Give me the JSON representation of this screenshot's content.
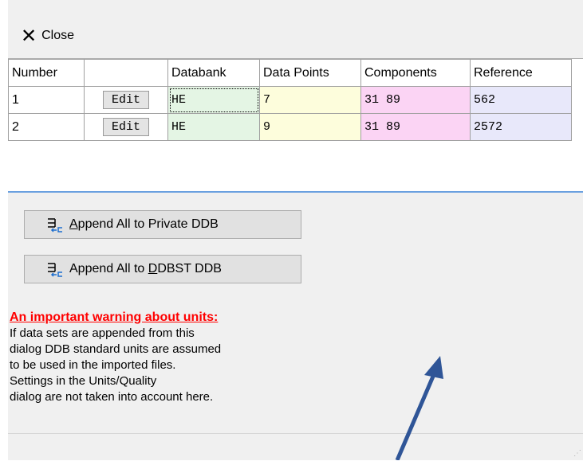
{
  "toolbar": {
    "close_label": "Close"
  },
  "table": {
    "headers": {
      "number": "Number",
      "edit": "",
      "databank": "Databank",
      "data_points": "Data Points",
      "components": "Components",
      "reference": "Reference"
    },
    "rows": [
      {
        "number": "1",
        "edit": "Edit",
        "databank": "HE",
        "data_points": "7",
        "components": "31 89",
        "reference": "562"
      },
      {
        "number": "2",
        "edit": "Edit",
        "databank": "HE",
        "data_points": "9",
        "components": "31 89",
        "reference": "2572"
      }
    ],
    "colors": {
      "databank": "#e4f5e4",
      "data_points": "#fdfddc",
      "components": "#fbd4f4",
      "reference": "#e8e8fa"
    }
  },
  "buttons": {
    "append_private": {
      "pre": "",
      "accel": "A",
      "post": "ppend All to Private DDB"
    },
    "append_ddbst": {
      "pre": "Append All to ",
      "accel": "D",
      "post": "DBST DDB"
    }
  },
  "warning": {
    "title": "An important warning about units:",
    "lines": [
      "If data sets are appended from this",
      "dialog DDB standard units are assumed",
      "to be used in the imported files.",
      "Settings in the Units/Quality",
      "dialog are not taken into account here."
    ]
  },
  "icons": {
    "close": "close-icon",
    "append": "append-icon",
    "annotation": "arrow-annotation"
  },
  "accent_color": "#2f5597"
}
